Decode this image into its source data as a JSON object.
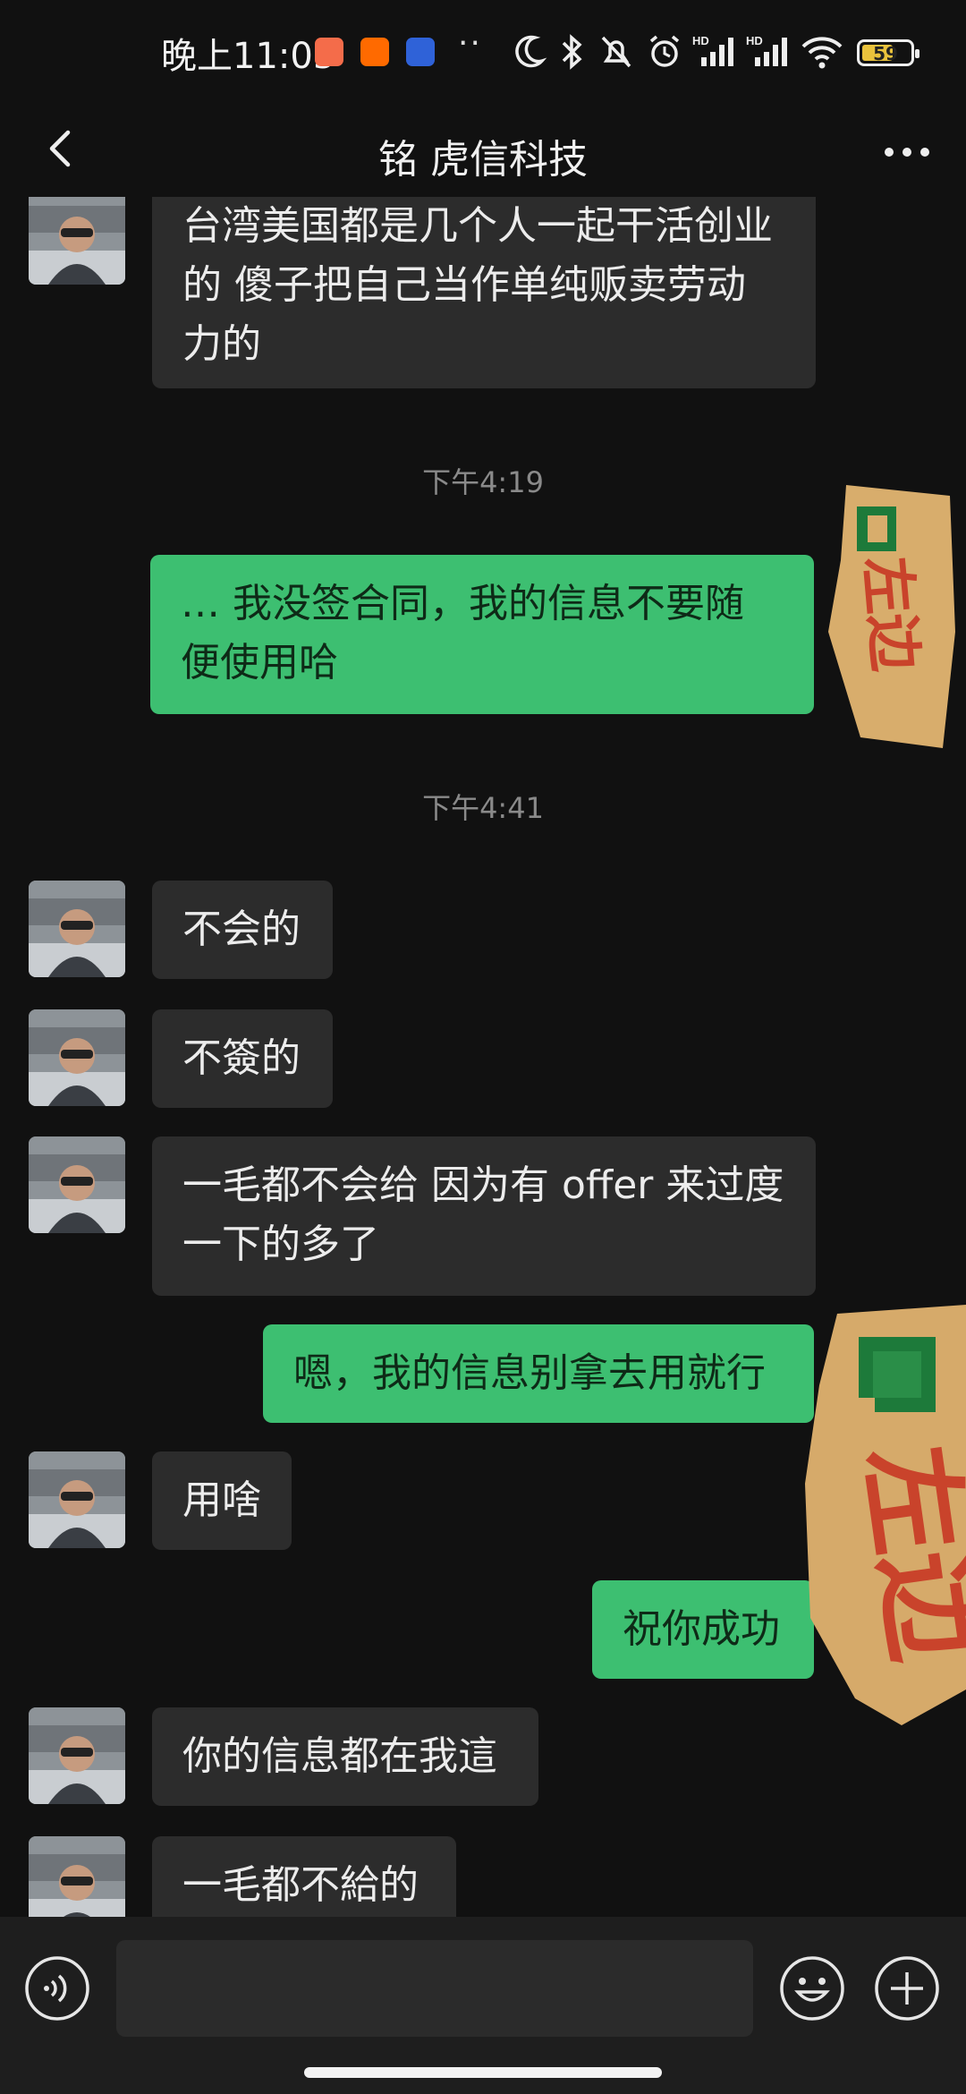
{
  "status_bar": {
    "time": "晚上11:05",
    "dots": "··",
    "network_1": "HD",
    "network_2": "HD",
    "battery": "59",
    "battery_fraction": 0.59
  },
  "header": {
    "title": "铭 虎信科技"
  },
  "messages": {
    "m1": {
      "line1": "台湾美国都是几个人一起干活创业",
      "line2": "的 傻子把自己当作单纯贩卖劳动",
      "line3": "力的"
    },
    "t1": "下午4:19",
    "m2": {
      "line1": "…  我没签合同，我的信息不要随",
      "line2": "便使用哈"
    },
    "t2": "下午4:41",
    "m3": "不会的",
    "m4": "不簽的",
    "m5": {
      "line1": "一毛都不会给 因为有 offer 来过度",
      "line2": "一下的多了"
    },
    "m6": "嗯，我的信息别拿去用就行",
    "m7": "用啥",
    "m8": "祝你成功",
    "m9": "你的信息都在我這",
    "m10": "一毛都不給的"
  },
  "stickers": {
    "text": "左边"
  },
  "icons": {
    "back": "chevron-left-icon",
    "more": "more-icon",
    "voice": "voice-icon",
    "emoji": "emoji-icon",
    "add": "plus-icon"
  },
  "colors": {
    "background": "#111111",
    "incoming_bubble": "#2c2c2c",
    "outgoing_bubble": "#3dbf71",
    "timestamp": "#8a8a8a"
  }
}
